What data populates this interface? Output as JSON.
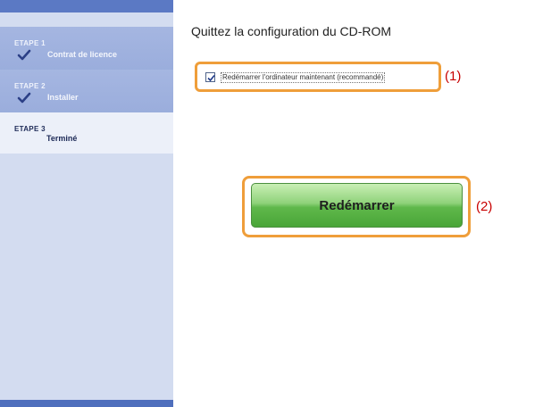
{
  "sidebar": {
    "steps": [
      {
        "number": "ETAPE 1",
        "label": "Contrat de licence",
        "done": true
      },
      {
        "number": "ETAPE 2",
        "label": "Installer",
        "done": true
      },
      {
        "number": "ETAPE 3",
        "label": "Terminé",
        "done": false
      }
    ]
  },
  "main": {
    "title": "Quittez la configuration du CD-ROM",
    "checkbox": {
      "label": "Redémarrer l'ordinateur maintenant (recommandé)",
      "checked": true
    },
    "callout1": "(1)",
    "restart_button": "Redémarrer",
    "callout2": "(2)"
  },
  "colors": {
    "sidebar_bg": "#d3dcf0",
    "step_done_bg": "#a5b6e1",
    "highlight_border": "#ef9e3a",
    "callout_text": "#c80000",
    "button_green": "#5fb84b"
  }
}
